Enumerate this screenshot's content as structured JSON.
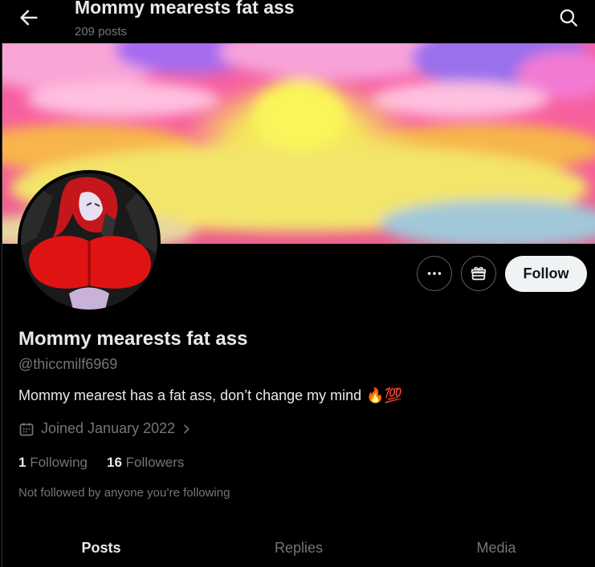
{
  "header": {
    "title": "Mommy mearests fat ass",
    "post_count": "209 posts",
    "back_icon": "arrow-left-icon",
    "search_icon": "search-icon"
  },
  "profile": {
    "display_name": "Mommy mearests fat ass",
    "handle": "@thiccmilf6969",
    "bio": "Mommy mearest has a fat ass, don’t change my mind",
    "bio_emoji": "🔥💯",
    "joined": "Joined January 2022",
    "following_count": "1",
    "following_label": "Following",
    "followers_count": "16",
    "followers_label": "Followers",
    "not_followed_note": "Not followed by anyone you’re following"
  },
  "actions": {
    "more_icon": "more-dots-icon",
    "subscribe_icon": "gift-icon",
    "follow_label": "Follow"
  },
  "tabs": [
    {
      "label": "Posts",
      "active": true
    },
    {
      "label": "Replies",
      "active": false
    },
    {
      "label": "Media",
      "active": false
    }
  ],
  "colors": {
    "background": "#000000",
    "text_primary": "#e7e9ea",
    "text_secondary": "#71767b",
    "follow_button_bg": "#eff3f4",
    "follow_button_text": "#0f1419",
    "border": "#536471"
  }
}
